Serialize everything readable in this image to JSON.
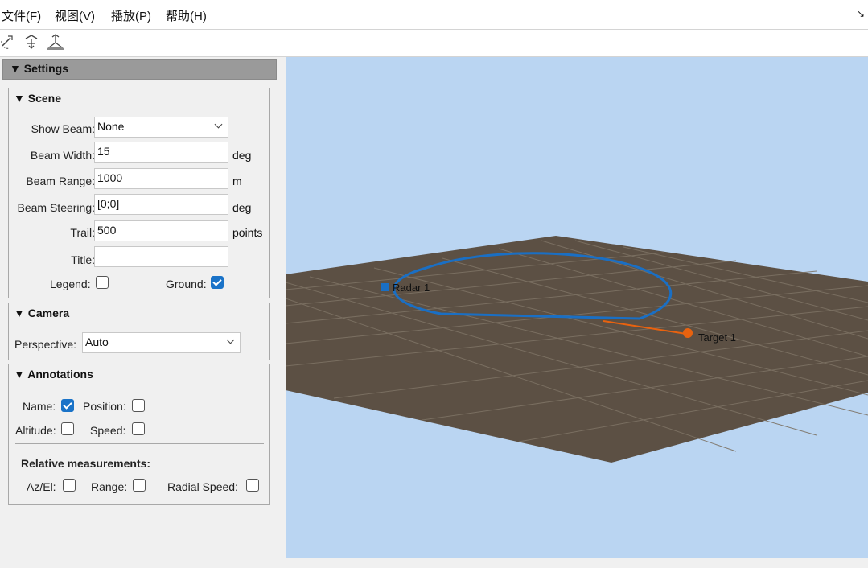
{
  "menu": {
    "file": "文件(F)",
    "view": "视图(V)",
    "play": "播放(P)",
    "help": "帮助(H)"
  },
  "toolbar": {
    "tools": [
      "rotate-tool-icon",
      "pan-tool-icon",
      "reset-view-icon"
    ]
  },
  "settings": {
    "header": "▼ Settings",
    "scene": {
      "title": "▼ Scene",
      "show_beam_label": "Show Beam:",
      "show_beam_value": "None",
      "beam_width_label": "Beam Width:",
      "beam_width_value": "15",
      "beam_width_unit": "deg",
      "beam_range_label": "Beam Range:",
      "beam_range_value": "1000",
      "beam_range_unit": "m",
      "beam_steering_label": "Beam Steering:",
      "beam_steering_value": "[0;0]",
      "beam_steering_unit": "deg",
      "trail_label": "Trail:",
      "trail_value": "500",
      "trail_unit": "points",
      "title_label": "Title:",
      "title_value": "",
      "legend_label": "Legend:",
      "legend_checked": false,
      "ground_label": "Ground:",
      "ground_checked": true
    },
    "camera": {
      "title": "▼ Camera",
      "perspective_label": "Perspective:",
      "perspective_value": "Auto"
    },
    "annotations": {
      "title": "▼ Annotations",
      "name_label": "Name:",
      "name_checked": true,
      "position_label": "Position:",
      "position_checked": false,
      "altitude_label": "Altitude:",
      "altitude_checked": false,
      "speed_label": "Speed:",
      "speed_checked": false,
      "relative_title": "Relative measurements:",
      "azel_label": "Az/El:",
      "azel_checked": false,
      "range_label": "Range:",
      "range_checked": false,
      "radial_speed_label": "Radial Speed:",
      "radial_speed_checked": false
    }
  },
  "scene": {
    "sky_color": "#bad5f2",
    "ground_color": "#5c5044",
    "radar_label": "Radar 1",
    "radar_color": "#1a6fc4",
    "target_label": "Target 1",
    "target_color": "#e8620f"
  },
  "colors": {
    "accent": "#1a73c8"
  }
}
